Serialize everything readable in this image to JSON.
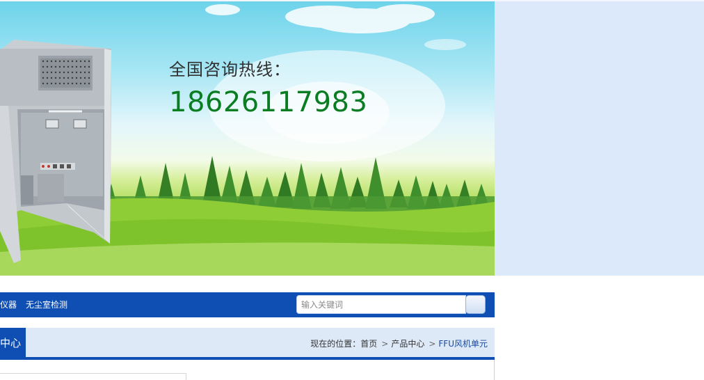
{
  "banner": {
    "hotline_label": "全国咨询热线：",
    "hotline_number": "18626117983",
    "product_image": "cleanroom-cabinet",
    "background": "sky-trees-grass"
  },
  "nav": {
    "items": [
      "仪器",
      "无尘室检测"
    ],
    "search": {
      "placeholder": "输入关键词",
      "value": ""
    },
    "search_icon": "search-button"
  },
  "section": {
    "title": "中心"
  },
  "breadcrumb": {
    "prefix": "现在的位置：",
    "items": [
      "首页",
      "产品中心",
      "FFU风机单元"
    ],
    "separator_icon": "chevron-right-icon"
  },
  "colors": {
    "nav_blue": "#0f4fb3",
    "crumb_bg": "#dde9f7",
    "right_panel": "#dbe9fb",
    "hotline_green": "#0a7d23"
  }
}
